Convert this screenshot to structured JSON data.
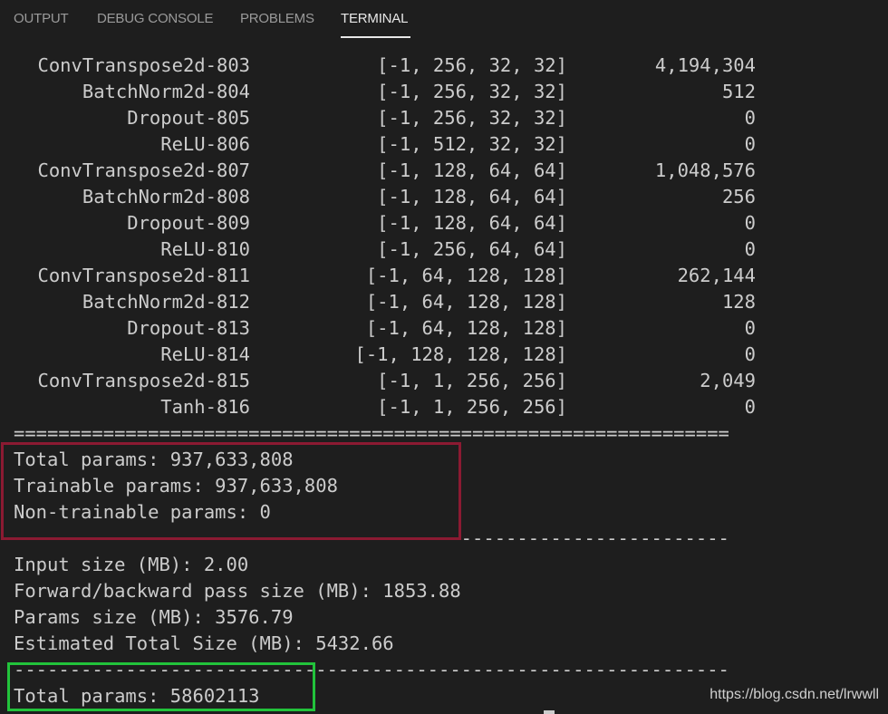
{
  "tabs": [
    {
      "label": "OUTPUT",
      "active": false
    },
    {
      "label": "DEBUG CONSOLE",
      "active": false
    },
    {
      "label": "PROBLEMS",
      "active": false
    },
    {
      "label": "TERMINAL",
      "active": true
    }
  ],
  "layers": [
    {
      "name": "ConvTranspose2d-803",
      "shape": "[-1, 256, 32, 32]",
      "params": "4,194,304"
    },
    {
      "name": "BatchNorm2d-804",
      "shape": "[-1, 256, 32, 32]",
      "params": "512"
    },
    {
      "name": "Dropout-805",
      "shape": "[-1, 256, 32, 32]",
      "params": "0"
    },
    {
      "name": "ReLU-806",
      "shape": "[-1, 512, 32, 32]",
      "params": "0"
    },
    {
      "name": "ConvTranspose2d-807",
      "shape": "[-1, 128, 64, 64]",
      "params": "1,048,576"
    },
    {
      "name": "BatchNorm2d-808",
      "shape": "[-1, 128, 64, 64]",
      "params": "256"
    },
    {
      "name": "Dropout-809",
      "shape": "[-1, 128, 64, 64]",
      "params": "0"
    },
    {
      "name": "ReLU-810",
      "shape": "[-1, 256, 64, 64]",
      "params": "0"
    },
    {
      "name": "ConvTranspose2d-811",
      "shape": "[-1, 64, 128, 128]",
      "params": "262,144"
    },
    {
      "name": "BatchNorm2d-812",
      "shape": "[-1, 64, 128, 128]",
      "params": "128"
    },
    {
      "name": "Dropout-813",
      "shape": "[-1, 64, 128, 128]",
      "params": "0"
    },
    {
      "name": "ReLU-814",
      "shape": "[-1, 128, 128, 128]",
      "params": "0"
    },
    {
      "name": "ConvTranspose2d-815",
      "shape": "[-1, 1, 256, 256]",
      "params": "2,049"
    },
    {
      "name": "Tanh-816",
      "shape": "[-1, 1, 256, 256]",
      "params": "0"
    }
  ],
  "summary": {
    "double_rule": "================================================================",
    "total_params": "Total params: 937,633,808",
    "trainable_params": "Trainable params: 937,633,808",
    "non_trainable_params": "Non-trainable params: 0",
    "single_rule": "----------------------------------------------------------------",
    "input_size": "Input size (MB): 2.00",
    "forward_backward_size": "Forward/backward pass size (MB): 1853.88",
    "params_size": "Params size (MB): 3576.79",
    "estimated_total_size": "Estimated Total Size (MB): 5432.66",
    "single_rule_2": "----------------------------------------------------------------",
    "total_params_2": "Total params: 58602113"
  },
  "watermark": "https://blog.csdn.net/lrwwll",
  "colors": {
    "background": "#1e1e1e",
    "text": "#cccccc",
    "red_box": "#8b1a32",
    "green_box": "#22c33b"
  }
}
